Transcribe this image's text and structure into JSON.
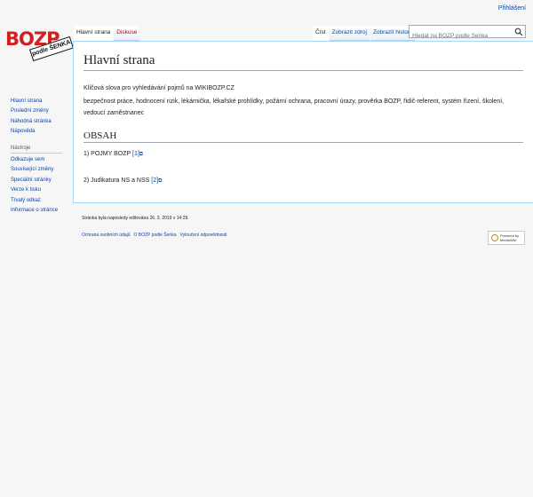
{
  "personal": {
    "login": "Přihlášení"
  },
  "logo": {
    "text": "BOZP",
    "stamp": "podle ŠENKA"
  },
  "tabs": {
    "left": [
      {
        "label": "Hlavní strana",
        "state": "selected"
      },
      {
        "label": "Diskuse",
        "state": "new"
      }
    ],
    "right": [
      {
        "label": "Číst",
        "state": "selected"
      },
      {
        "label": "Zobrazit zdroj",
        "state": ""
      },
      {
        "label": "Zobrazit historii",
        "state": ""
      }
    ]
  },
  "search": {
    "placeholder": "Hledat na BOZP podle Šenka",
    "icon": "search-icon"
  },
  "page": {
    "title": "Hlavní strana",
    "intro": "Klíčová slova pro vyhledávání pojmů na WIKIBOZP.CZ",
    "keywords": "bezpečnost práce, hodnocení rizik, lékárnička, lékařské prohlídky, požární ochrana, pracovní úrazy, prověrka BOZP, řidič-referent, systém řízení, školení, vedoucí zaměstnanec",
    "section_heading": "OBSAH",
    "item1_text": "1) POJMY BOZP",
    "item1_ref": "[1]",
    "item2_text": "2) Judikatura NS a NSS",
    "item2_ref": "[2]"
  },
  "sidebar": {
    "nav": [
      "Hlavní strana",
      "Poslední změny",
      "Náhodná stránka",
      "Nápověda"
    ],
    "tools_heading": "Nástroje",
    "tools": [
      "Odkazuje sem",
      "Související změny",
      "Speciální stránky",
      "Verze k tisku",
      "Trvalý odkaz",
      "Informace o stránce"
    ]
  },
  "footer": {
    "last_modified": "Stránka byla naposledy editována 26. 3. 2019 v 14:29.",
    "links": [
      "Ochrana osobních údajů",
      "O BOZP podle Šenka",
      "Vyloučení odpovědnosti"
    ],
    "powered": "Powered by",
    "mediawiki": "MediaWiki"
  }
}
